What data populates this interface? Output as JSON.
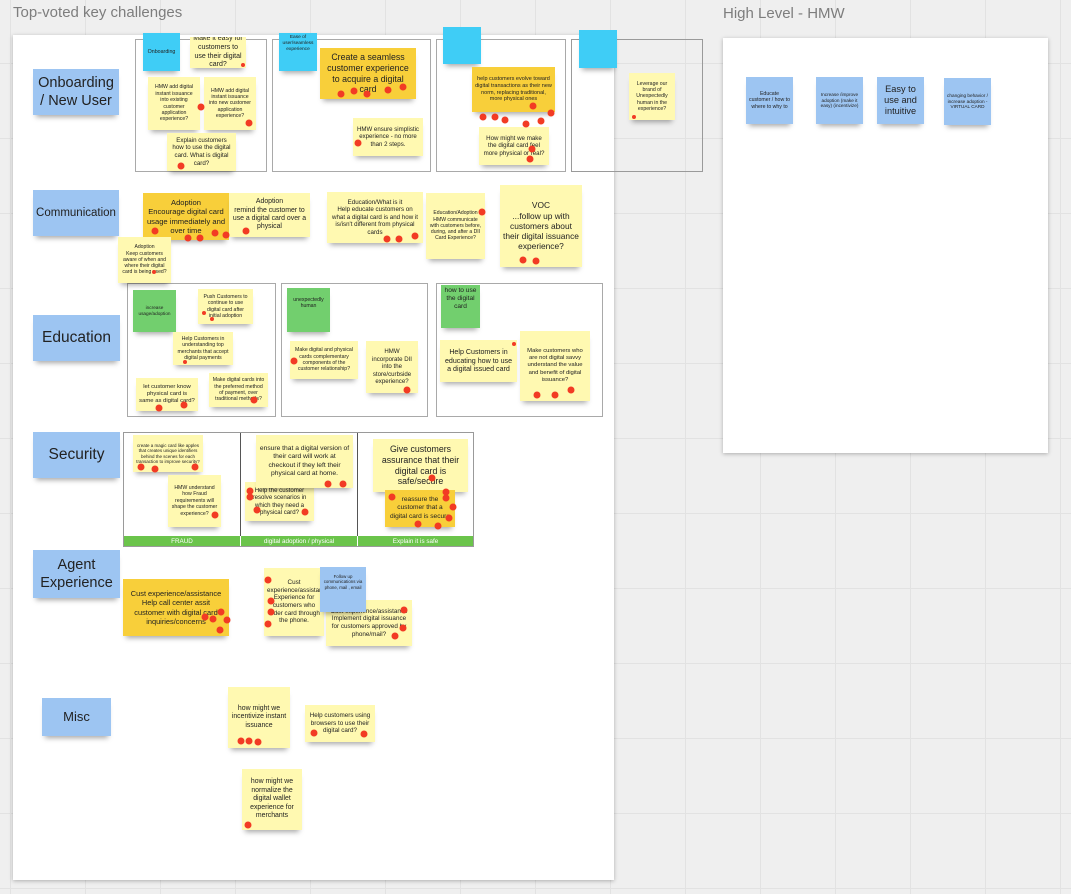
{
  "colors": {
    "canvas": "#efefef",
    "label_blue": "#9dc5f2",
    "cyan": "#3fcdf6",
    "yellow": "#fff9b1",
    "dark_yellow": "#f8cf3a",
    "green": "#72cf6e",
    "frame_footer_green": "#6bc44b",
    "vote_dot": "#f23b24"
  },
  "top_voted": {
    "title": "Top-voted key challenges",
    "rows": {
      "onboarding": {
        "label": "Onboarding\n/ New User",
        "stickies": [
          {
            "text": "Onboarding",
            "color": "cyan",
            "votes": 0
          },
          {
            "text": "Make it easy for customers to use their digital card?",
            "color": "yellow",
            "votes": 1
          },
          {
            "text": "HMW add digital instant issuance into existing customer application experience?",
            "color": "yellow",
            "votes": 1
          },
          {
            "text": "HMW add digital instant issuance into new customer application experience?",
            "color": "yellow",
            "votes": 1
          },
          {
            "text": "Explain customers how to use the digital card. What is digital card?",
            "color": "yellow",
            "votes": 1
          },
          {
            "text": "Ease of user/seamless experience",
            "color": "cyan",
            "votes": 0
          },
          {
            "text": "Create a seamless customer experience to acquire a digital card",
            "color": "dark_yellow",
            "votes": 5
          },
          {
            "text": "HMW ensure simplistic experience - no more than 2 steps.",
            "color": "yellow",
            "votes": 1
          },
          {
            "text": "",
            "color": "cyan",
            "votes": 0
          },
          {
            "text": "help customers evolve toward digital transactions as their new norm, replacing traditional, more physical ones",
            "color": "dark_yellow",
            "votes": 7
          },
          {
            "text": "How might we make the digital card feel more physical or real?",
            "color": "yellow",
            "votes": 2
          },
          {
            "text": "",
            "color": "cyan",
            "votes": 0
          },
          {
            "text": "Leverage our brand of Unexpectedly human in the experience?",
            "color": "yellow",
            "votes": 1
          }
        ]
      },
      "communication": {
        "label": "Communication",
        "stickies": [
          {
            "text": "Adoption\nEncourage digital card usage immediately and over time",
            "color": "dark_yellow",
            "votes": 5
          },
          {
            "text": "Adoption\nremind the customer to use a digital card over a physical",
            "color": "yellow",
            "votes": 1
          },
          {
            "text": "Adoption\nKeep customers aware of when and where their digital card is being used?",
            "color": "yellow",
            "votes": 1
          },
          {
            "text": "Education/What is it\nHelp educate customers on what a digital card is and how it is/isn't different from physical cards",
            "color": "yellow",
            "votes": 3
          },
          {
            "text": "Education/Adoption\nHMW communicate with customers before, during, and after a DII Card Experience?",
            "color": "yellow",
            "votes": 1
          },
          {
            "text": "VOC\n...follow up with customers about their digital issuance experience?",
            "color": "yellow",
            "votes": 2
          }
        ]
      },
      "education": {
        "label": "Education",
        "stickies": [
          {
            "text": "increase usage/adoption",
            "color": "green",
            "votes": 0
          },
          {
            "text": "Push Customers to continue to use digital card after initial adoption",
            "color": "yellow",
            "votes": 2
          },
          {
            "text": "Help Customers in understanding top merchants that accept digital payments",
            "color": "yellow",
            "votes": 1
          },
          {
            "text": "let customer know physical card is same as digital card?",
            "color": "yellow",
            "votes": 2
          },
          {
            "text": "Make digital cards into the preferred method of payment, over traditional methods?",
            "color": "yellow",
            "votes": 1
          },
          {
            "text": "unexpectedly human",
            "color": "green",
            "votes": 0
          },
          {
            "text": "Make digital and physical cards complementary components of the customer relationship?",
            "color": "yellow",
            "votes": 1
          },
          {
            "text": "HMW incorporate DII into the store/curbside experience?",
            "color": "yellow",
            "votes": 1
          },
          {
            "text": "how to use the digital card",
            "color": "green",
            "votes": 0
          },
          {
            "text": "Help Customers in educating how to use a digital issued card",
            "color": "yellow",
            "votes": 1
          },
          {
            "text": "Make customers who are not digital savvy understand the value and benefit of digital issuance?",
            "color": "yellow",
            "votes": 3
          }
        ]
      },
      "security": {
        "label": "Security",
        "frame_sections": [
          "FRAUD",
          "digital adoption / physical",
          "Explain it is safe"
        ],
        "stickies": [
          {
            "text": "create a magic card like apples that creates unique identifiers behind the scenes for each transaction to improve security?",
            "color": "yellow",
            "votes": 3
          },
          {
            "text": "HMW understand how Fraud requirements will shape the customer experience?",
            "color": "yellow",
            "votes": 1
          },
          {
            "text": "Help the customer resolve scenarios in which they need a physical card?",
            "color": "yellow",
            "votes": 4
          },
          {
            "text": "ensure that a digital version of their card will work at checkout if they left their physical card at home.",
            "color": "yellow",
            "votes": 2
          },
          {
            "text": "Give customers assurance that their digital card is safe/secure",
            "color": "yellow",
            "votes": 1
          },
          {
            "text": "reassure the customer that a digital card is secure",
            "color": "dark_yellow",
            "votes": 7
          }
        ]
      },
      "agent": {
        "label": "Agent\nExperience",
        "stickies": [
          {
            "text": "Cust experience/assistance\nHelp call center assit customer with digital card inquiries/concerns",
            "color": "dark_yellow",
            "votes": 5
          },
          {
            "text": "Cust\nexperience/assistance Experience for customers who order card through the phone.",
            "color": "yellow",
            "votes": 4
          },
          {
            "text": "Cust experience/assistance\nImplement digital issuance for customers approved by phone/mail?",
            "color": "yellow",
            "votes": 3
          },
          {
            "text": "Follow up communications via phone, mail , email",
            "color": "blue",
            "votes": 0
          }
        ]
      },
      "misc": {
        "label": "Misc",
        "stickies": [
          {
            "text": "how might we incentivize instant issuance",
            "color": "yellow",
            "votes": 3
          },
          {
            "text": "Help customers using browsers to use their digital card?",
            "color": "yellow",
            "votes": 2
          },
          {
            "text": "how might we normalize the digital wallet experience for merchants",
            "color": "yellow",
            "votes": 1
          }
        ]
      }
    }
  },
  "high_level": {
    "title": "High Level - HMW",
    "stickies": [
      {
        "text": "Educate customer / how to where to why to",
        "color": "blue"
      },
      {
        "text": "Increase /improve adoption (make it easy) (incentivize)",
        "color": "blue"
      },
      {
        "text": "Easy to use and intuitive",
        "color": "blue"
      },
      {
        "text": "changing behavior / increase adoption - VIRTUAL CARD",
        "color": "blue"
      }
    ]
  }
}
